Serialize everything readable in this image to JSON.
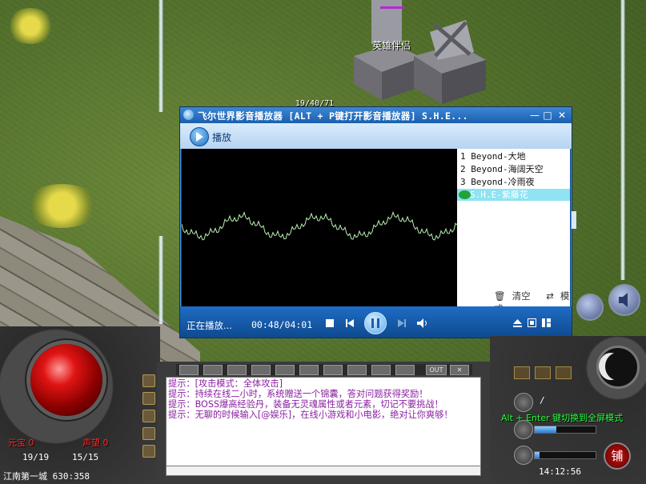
{
  "scene": {
    "npc_name": "英雄伴侣",
    "npc_hp_color": "#b12ad6",
    "overlay_coords_partial": "19/40/71"
  },
  "player": {
    "title": "飞尔世界影音播放器 [ALT + P键打开影音播放器] S.H.E...",
    "minimize": "—",
    "restore": "□",
    "close": "✕",
    "play_label": "播放",
    "playlist": [
      {
        "index": "1",
        "title": "Beyond-大地"
      },
      {
        "index": "2",
        "title": "Beyond-海阔天空"
      },
      {
        "index": "3",
        "title": "Beyond-冷雨夜"
      },
      {
        "index": "",
        "title": "S.H.E-紫藤花"
      }
    ],
    "active_track": 3,
    "clear_label": "清空",
    "mode_label": "模式",
    "status": "正在播放...",
    "time": "00:48/04:01",
    "accent": "#1a5fae",
    "wave_color": "#b8f0b0"
  },
  "chat": {
    "lines": [
      "提示：[攻击模式：全体攻击]",
      "提示：持续在线二小时，系统赠送一个锦囊，答对问题获得奖励！",
      "提示：BOSS爆高经验丹，装备无灵魂属性或者元素，切记不要挑战！",
      "提示：无聊的时候输入[@娱乐]，在线小游戏和小电影，绝对让你爽够！"
    ],
    "buttons": [
      "OUT",
      "✕"
    ],
    "text_color": "#8a1fa0"
  },
  "hud": {
    "hp_label": "元宝",
    "hp_label_value": "0",
    "mp_label": "声望",
    "mp_label_value": "0",
    "hp": "19/19",
    "mp": "15/15",
    "location": "江南第一城 630:358",
    "fullscreen_hint": "Alt + Enter 键切换到全屏模式",
    "clock": "14:12:56",
    "shop_label": "铺",
    "level_mark": "/",
    "exp_fill": 0.35,
    "weight_fill": 0.08
  }
}
